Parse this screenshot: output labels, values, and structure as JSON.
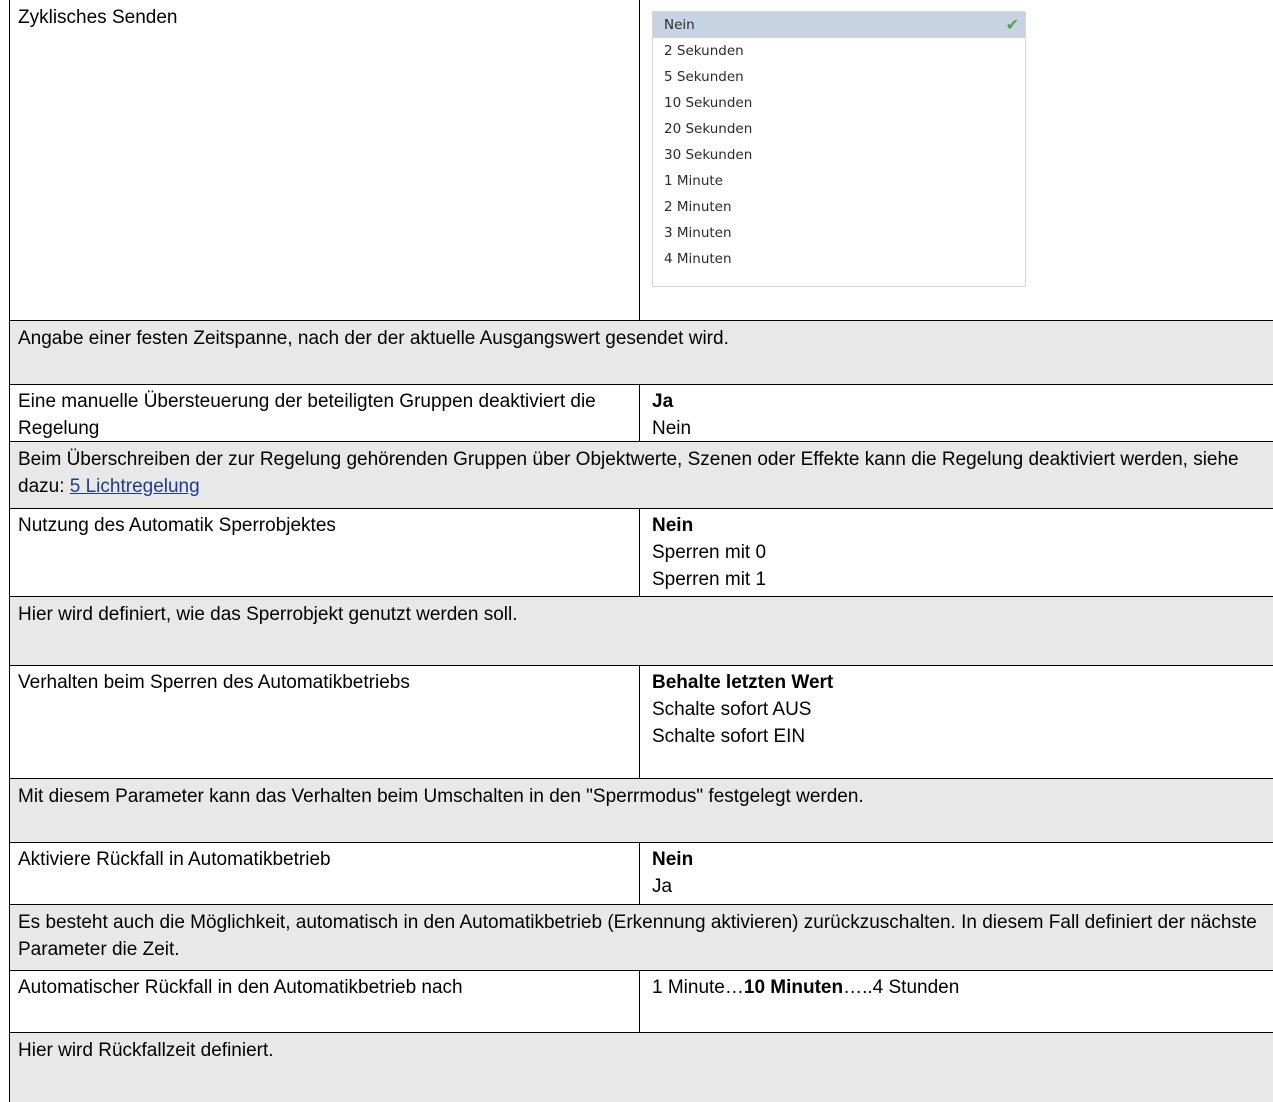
{
  "rows": {
    "zyklisch": {
      "name": "Zyklisches Senden",
      "dropdown": {
        "items": [
          "Nein",
          "2 Sekunden",
          "5 Sekunden",
          "10 Sekunden",
          "20 Sekunden",
          "30 Sekunden",
          "1 Minute",
          "2 Minuten",
          "3 Minuten",
          "4 Minuten"
        ],
        "selected": "Nein"
      }
    },
    "zyklisch_desc": "Angabe einer festen Zeitspanne, nach der der aktuelle Ausgangswert gesendet wird.",
    "uebersteuerung": {
      "name": "Eine manuelle Übersteuerung der beteiligten Gruppen deaktiviert die Regelung",
      "options": [
        "Ja",
        "Nein"
      ]
    },
    "uebersteuerung_desc": {
      "text": "Beim Überschreiben der zur Regelung gehörenden Gruppen über Objektwerte, Szenen oder Effekte kann die Regelung deaktiviert werden, siehe dazu: ",
      "link": "5 Lichtregelung"
    },
    "sperrobjekt": {
      "name": "Nutzung des Automatik Sperrobjektes",
      "options": [
        "Nein",
        "Sperren mit 0",
        "Sperren mit 1"
      ]
    },
    "sperrobjekt_desc": "Hier wird definiert, wie das Sperrobjekt genutzt werden soll.",
    "verhalten": {
      "name": "Verhalten beim Sperren des Automatikbetriebs",
      "options": [
        "Behalte letzten Wert",
        "Schalte sofort AUS",
        "Schalte sofort EIN"
      ]
    },
    "verhalten_desc": "Mit diesem Parameter kann das Verhalten beim Umschalten in den \"Sperrmodus\" festgelegt werden.",
    "rueckfall": {
      "name": "Aktiviere Rückfall in Automatikbetrieb",
      "options": [
        "Nein",
        "Ja"
      ]
    },
    "rueckfall_desc": "Es besteht auch die Möglichkeit, automatisch in den Automatikbetrieb (Erkennung aktivieren) zurückzuschalten. In diesem Fall definiert der nächste Parameter die Zeit.",
    "rueckfall_zeit": {
      "name": "Automatischer Rückfall in den Automatikbetrieb nach",
      "range_start": "1 Minute…",
      "range_default": "10 Minuten",
      "range_end": "…..4 Stunden"
    },
    "rueckfall_zeit_desc": "Hier wird Rückfallzeit definiert."
  },
  "colors": {
    "description_background": "#e8e8e8",
    "dropdown_selected": "#c7d3e3",
    "checkmark": "#5aa14a",
    "link": "#1f3a93"
  }
}
